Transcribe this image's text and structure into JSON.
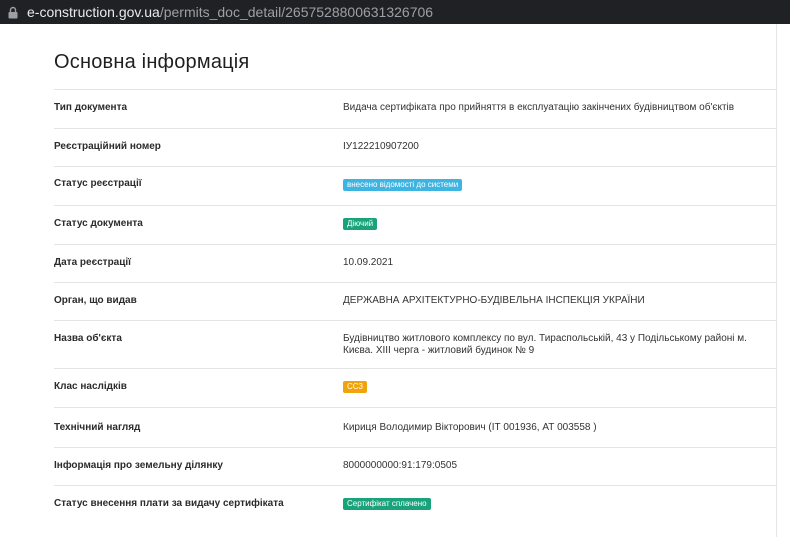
{
  "browser": {
    "domain": "e-construction.gov.ua",
    "path": "/permits_doc_detail/2657528800631326706"
  },
  "page": {
    "title": "Основна інформація"
  },
  "rows": [
    {
      "label": "Тип документа",
      "value": "Видача сертифіката про прийняття в експлуатацію закінчених будівництвом об'єктів"
    },
    {
      "label": "Реєстраційний номер",
      "value": "ІУ122210907200"
    },
    {
      "label": "Статус реєстрації",
      "value": "внесено відомості до системи"
    },
    {
      "label": "Статус документа",
      "value": "Діючий"
    },
    {
      "label": "Дата реєстрації",
      "value": "10.09.2021"
    },
    {
      "label": "Орган, що видав",
      "value": "ДЕРЖАВНА АРХІТЕКТУРНО-БУДІВЕЛЬНА ІНСПЕКЦІЯ УКРАЇНИ"
    },
    {
      "label": "Назва об'єкта",
      "value": "Будівництво житлового комплексу по вул. Тираспольській, 43 у Подільському районі м. Києва. XIII черга - житловий будинок № 9"
    },
    {
      "label": "Клас наслідків",
      "value": "СС3"
    },
    {
      "label": "Технічний нагляд",
      "value": "Кириця Володимир Вікторович (ІТ 001936, АТ 003558 )"
    },
    {
      "label": "Інформація про земельну ділянку",
      "value": "8000000000:91:179:0505"
    },
    {
      "label": "Статус внесення плати за видачу сертифіката",
      "value": "Сертифікат сплачено"
    }
  ],
  "colors": {
    "badge_blue": "#3db4e1",
    "badge_green": "#1aa37a",
    "badge_orange": "#f0a30a"
  }
}
